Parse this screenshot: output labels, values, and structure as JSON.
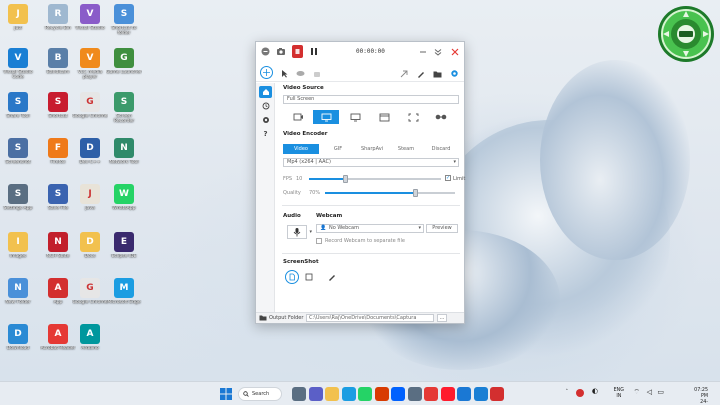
{
  "desktop": {
    "icons": [
      {
        "label": "Jutt",
        "icon": "folder-icon",
        "color": "#f2c14e"
      },
      {
        "label": "Recycle Bin",
        "icon": "recycle-bin-icon",
        "color": "#9fb8d0"
      },
      {
        "label": "Visual Studio",
        "icon": "visual-studio-icon",
        "color": "#8a5cc9"
      },
      {
        "label": "Shortcut to folder",
        "icon": "shortcut-folder-icon",
        "color": "#4a90d9"
      },
      {
        "label": "Visual Studio Code",
        "icon": "vscode-icon",
        "color": "#1a7fd4"
      },
      {
        "label": "Bandicam",
        "icon": "bandicam-icon",
        "color": "#5a7fa8"
      },
      {
        "label": "VLC media player",
        "icon": "vlc-icon",
        "color": "#f08a1c"
      },
      {
        "label": "Game Launcher",
        "icon": "game-icon",
        "color": "#3f8f3f"
      },
      {
        "label": "Share Tool",
        "icon": "share-icon",
        "color": "#2a78c8"
      },
      {
        "label": "Shortcut",
        "icon": "app-shortcut-icon",
        "color": "#c81c2f"
      },
      {
        "label": "Google Chrome",
        "icon": "chrome-icon",
        "color": "#e6e6e6"
      },
      {
        "label": "Screen Recorder",
        "icon": "screen-recorder-icon",
        "color": "#3b9a6b"
      },
      {
        "label": "Screenshot",
        "icon": "screenshot-icon",
        "color": "#4b6fa3"
      },
      {
        "label": "Firefox",
        "icon": "firefox-icon",
        "color": "#ef7a1a"
      },
      {
        "label": "Dev-C++",
        "icon": "devcpp-icon",
        "color": "#2d5fa8"
      },
      {
        "label": "Network Tool",
        "icon": "network-tool-icon",
        "color": "#2f8a6a"
      },
      {
        "label": "Settings App",
        "icon": "settings-app-icon",
        "color": "#5a6e82"
      },
      {
        "label": "Save File",
        "icon": "save-file-icon",
        "color": "#3a63b0"
      },
      {
        "label": "Java",
        "icon": "java-icon",
        "color": "#e8e3d8"
      },
      {
        "label": "WhatsApp",
        "icon": "whatsapp-icon",
        "color": "#25d366"
      },
      {
        "label": "Images",
        "icon": "user-folder-icon",
        "color": "#f2c14e"
      },
      {
        "label": "NCH Suite",
        "icon": "nch-icon",
        "color": "#c21f2b"
      },
      {
        "label": "Docs",
        "icon": "folder-icon",
        "color": "#f2c14e"
      },
      {
        "label": "Eclipse IDE",
        "icon": "eclipse-icon",
        "color": "#3a2a6e"
      },
      {
        "label": "New Folder",
        "icon": "folder-icon",
        "color": "#4a90d9"
      },
      {
        "label": "App",
        "icon": "red-app-icon",
        "color": "#d32f2f"
      },
      {
        "label": "Google Chrome",
        "icon": "chrome-icon",
        "color": "#e6e6e6"
      },
      {
        "label": "Microsoft Edge",
        "icon": "edge-icon",
        "color": "#1b9de2"
      },
      {
        "label": "Download",
        "icon": "download-icon",
        "color": "#2a8ad4"
      },
      {
        "label": "Acrobat Reader",
        "icon": "acrobat-icon",
        "color": "#e53935"
      },
      {
        "label": "Arduino",
        "icon": "arduino-icon",
        "color": "#00979d"
      }
    ]
  },
  "app": {
    "timer": "00:00:00",
    "video_source_title": "Video Source",
    "video_source_value": "Full Screen",
    "video_encoder_title": "Video Encoder",
    "encoder_tabs": [
      "Video",
      "GIF",
      "SharpAvi",
      "Steam",
      "Discard"
    ],
    "codec_value": "Mp4 (x264 | AAC)",
    "fps_label": "FPS",
    "fps_value": "10",
    "limit_label": "Limit",
    "quality_label": "Quality",
    "quality_value": "70%",
    "audio_title": "Audio",
    "webcam_title": "Webcam",
    "webcam_value": "No Webcam",
    "preview_label": "Preview",
    "record_webcam_label": "Record Webcam to separate file",
    "screenshot_title": "ScreenShot",
    "output_folder_label": "Output Folder",
    "output_folder_path": "C:\\Users\\Raj\\OneDrive\\Documents\\Captura"
  },
  "taskbar": {
    "search_label": "Search",
    "language_top": "ENG",
    "language_bottom": "IN",
    "time": "07:25 PM",
    "date": "24-01-2023"
  },
  "colors": {
    "accent": "#1a8fe0",
    "record": "#d32f2f",
    "close": "#e53935"
  }
}
